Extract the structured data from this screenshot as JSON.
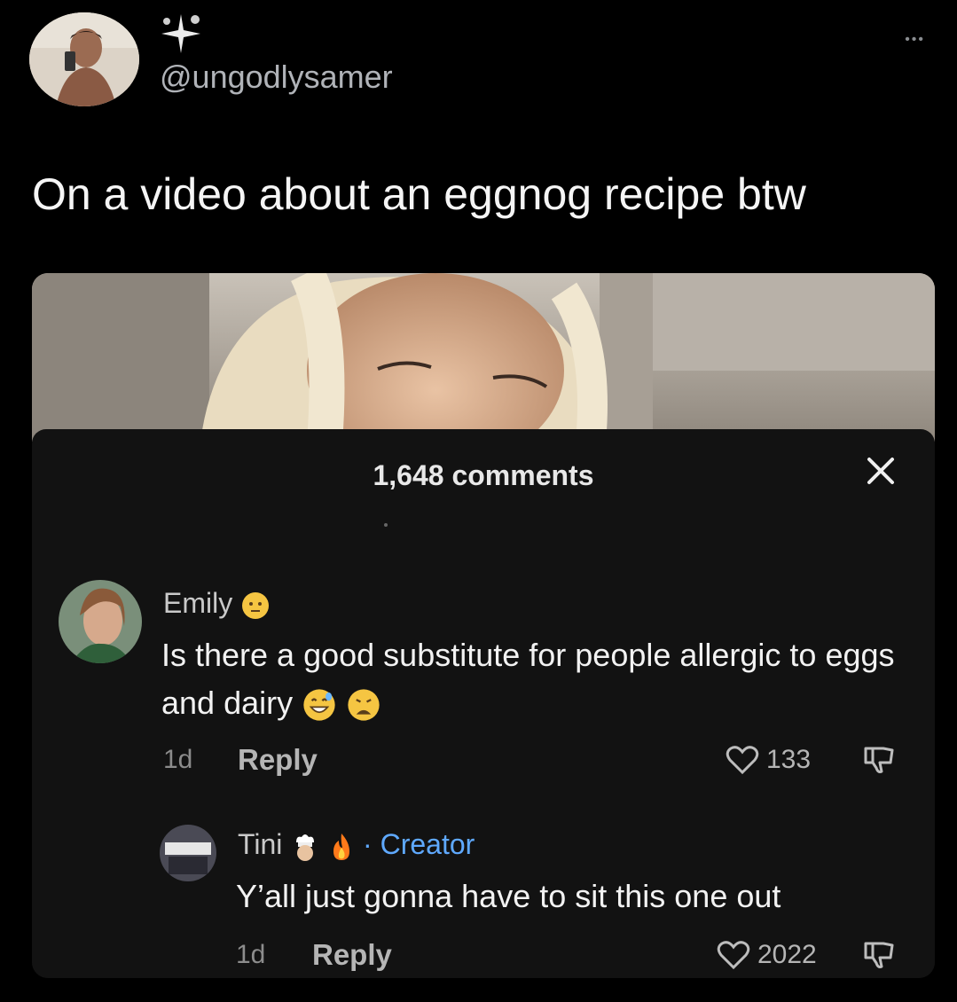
{
  "tweet": {
    "handle": "@ungodlysamer",
    "text": "On a video about an eggnog recipe btw",
    "more_label": "•••"
  },
  "comments_panel": {
    "count_label": "1,648 comments",
    "comments": [
      {
        "name": "Emily",
        "text": "Is there a good substitute for people allergic to eggs and dairy",
        "age": "1d",
        "reply_label": "Reply",
        "likes": "133"
      },
      {
        "name": "Tini",
        "creator_label": "· Creator",
        "text": "Y’all just gonna have to sit this one out",
        "age": "1d",
        "reply_label": "Reply",
        "likes": "2022"
      }
    ]
  },
  "colors": {
    "background": "#000000",
    "panel": "#121212",
    "creator": "#5fa9ff"
  },
  "icons": [
    "more-icon",
    "sparkle-icon",
    "close-icon",
    "heart-icon",
    "dislike-icon",
    "emoji-icon"
  ]
}
